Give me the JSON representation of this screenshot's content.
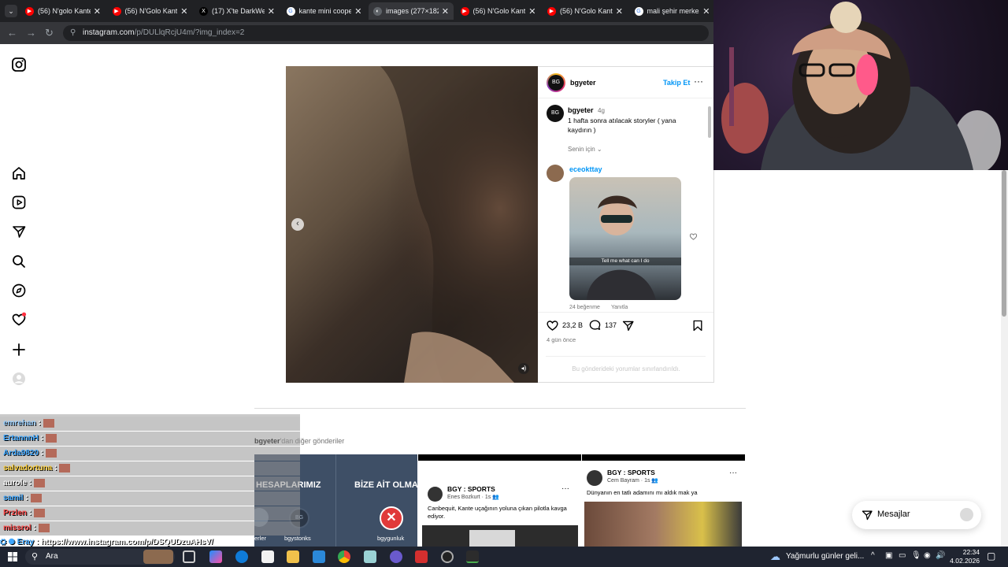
{
  "browser": {
    "tabs": [
      {
        "title": "(56) N'golo Kante",
        "kind": "youtube"
      },
      {
        "title": "(56) N'Golo Kante",
        "kind": "youtube"
      },
      {
        "title": "(17) X'te DarkWe",
        "kind": "x"
      },
      {
        "title": "kante mini coope",
        "kind": "google"
      },
      {
        "title": "images (277×182)",
        "kind": "image"
      },
      {
        "title": "(56) N'Golo Kante",
        "kind": "youtube"
      },
      {
        "title": "(56) N'Golo Kante",
        "kind": "youtube"
      },
      {
        "title": "mali şehir merkez",
        "kind": "google"
      }
    ],
    "url_domain": "instagram.com",
    "url_path": "/p/DULlqRcjU4m/?img_index=2"
  },
  "post": {
    "username": "bgyeter",
    "follow_label": "Takip Et",
    "caption_user": "bgyeter",
    "caption_age": "4g",
    "caption_text": "1 hafta sonra atılacak storyler ( yana kaydırın )",
    "for_you_label": "Senin için",
    "comment_user": "eceokttay",
    "comment_image_caption": "Tell me what can I do",
    "comment_likes": "24 beğenme",
    "reply_label": "Yanıtla",
    "likes_count": "23,2 B",
    "comments_count": "137",
    "time_ago": "4 gün önce",
    "comments_restricted": "Bu gönderideki yorumlar sınırlandırıldı."
  },
  "more_posts": {
    "heading_user": "bgyeter",
    "heading_suffix": "'dan diğer gönderiler",
    "tile1": {
      "text_left": "HESAPLARIMIZ",
      "text_right": "BİZE AİT OLMAY",
      "label_a": "erler",
      "label_b": "bgystonks",
      "label_c": "bgygunluk"
    },
    "tile2": {
      "account": "BGY : SPORTS",
      "author": "Enes Bozkurt",
      "age": "1s",
      "text": "Canbequit, Kante uçağının yoluna çıkan pilotla kavga ediyor."
    },
    "tile3": {
      "account": "BGY : SPORTS",
      "author": "Cem Bayram",
      "age": "1s",
      "text": "Dünyanın en tatlı adamını mı aldık mak ya"
    }
  },
  "messages_button": "Mesajlar",
  "chat": [
    {
      "user": "emrehan",
      "color": "#9ad0ff"
    },
    {
      "user": "ErtannnH",
      "color": "#3fa7ff"
    },
    {
      "user": "Arda9820",
      "color": "#3fa7ff"
    },
    {
      "user": "salvadortuna",
      "color": "#ffd23f"
    },
    {
      "user": "aurole",
      "color": "#ffffff"
    },
    {
      "user": "samil",
      "color": "#3fa7ff"
    },
    {
      "user": "Przlen",
      "color": "#ff4b4b"
    },
    {
      "user": "missrol",
      "color": "#ff4b4b"
    }
  ],
  "chat_last": {
    "user": "Eray",
    "text": "https://www.instagram.com/p/DSQUDzuAHsV/"
  },
  "taskbar": {
    "search": "Ara",
    "weather": "Yağmurlu günler geli...",
    "time": "22:34",
    "date": "4.02.2026"
  }
}
